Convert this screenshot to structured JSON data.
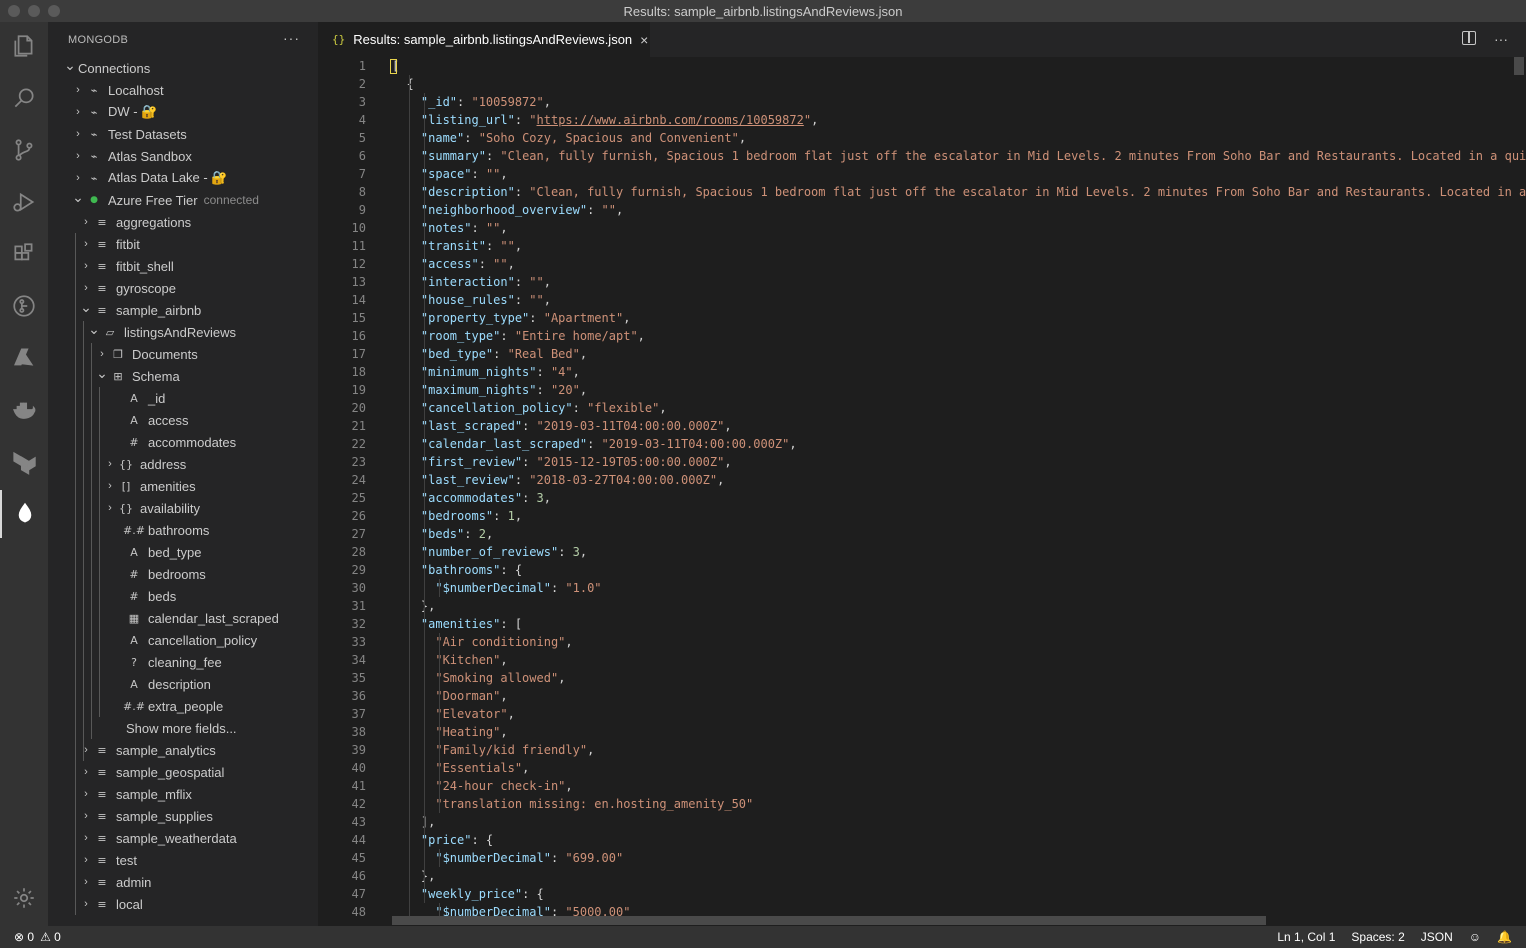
{
  "window": {
    "title": "Results: sample_airbnb.listingsAndReviews.json"
  },
  "activity_bar": [
    {
      "icon": "files-icon"
    },
    {
      "icon": "search-icon"
    },
    {
      "icon": "source-control-icon"
    },
    {
      "icon": "run-debug-icon"
    },
    {
      "icon": "extensions-icon"
    },
    {
      "icon": "gitlens-icon"
    },
    {
      "icon": "azure-icon"
    },
    {
      "icon": "docker-icon"
    },
    {
      "icon": "terraform-icon"
    },
    {
      "icon": "mongodb-leaf-icon",
      "active": true
    }
  ],
  "sidebar": {
    "title": "MONGODB",
    "more": "···",
    "rows": [
      {
        "label": "Connections",
        "chevron": "⌄",
        "icon": "",
        "sub": ""
      },
      {
        "label": "Localhost",
        "chevron": "›",
        "icon": "plug-icon",
        "sub": ""
      },
      {
        "label": "DW - 🔐",
        "chevron": "›",
        "icon": "plug-icon",
        "sub": ""
      },
      {
        "label": "Test Datasets",
        "chevron": "›",
        "icon": "plug-icon",
        "sub": ""
      },
      {
        "label": "Atlas Sandbox",
        "chevron": "›",
        "icon": "plug-icon",
        "sub": ""
      },
      {
        "label": "Atlas Data Lake - 🔐",
        "chevron": "›",
        "icon": "plug-icon",
        "sub": ""
      },
      {
        "label": "Azure Free Tier",
        "chevron": "⌄",
        "icon": "connected-leaf-icon",
        "sub": "connected"
      },
      {
        "label": "aggregations",
        "chevron": "›",
        "icon": "database-icon",
        "sub": ""
      },
      {
        "label": "fitbit",
        "chevron": "›",
        "icon": "database-icon",
        "sub": ""
      },
      {
        "label": "fitbit_shell",
        "chevron": "›",
        "icon": "database-icon",
        "sub": ""
      },
      {
        "label": "gyroscope",
        "chevron": "›",
        "icon": "database-icon",
        "sub": ""
      },
      {
        "label": "sample_airbnb",
        "chevron": "⌄",
        "icon": "database-icon",
        "sub": ""
      },
      {
        "label": "listingsAndReviews",
        "chevron": "⌄",
        "icon": "folder-icon",
        "sub": ""
      },
      {
        "label": "Documents",
        "chevron": "›",
        "icon": "documents-icon",
        "sub": ""
      },
      {
        "label": "Schema",
        "chevron": "⌄",
        "icon": "schema-icon",
        "sub": ""
      },
      {
        "label": "_id",
        "chevron": "",
        "icon": "string-type-icon",
        "sub": ""
      },
      {
        "label": "access",
        "chevron": "",
        "icon": "string-type-icon",
        "sub": ""
      },
      {
        "label": "accommodates",
        "chevron": "",
        "icon": "number-type-icon",
        "sub": ""
      },
      {
        "label": "address",
        "chevron": "›",
        "icon": "object-type-icon",
        "sub": ""
      },
      {
        "label": "amenities",
        "chevron": "›",
        "icon": "array-type-icon",
        "sub": ""
      },
      {
        "label": "availability",
        "chevron": "›",
        "icon": "object-type-icon",
        "sub": ""
      },
      {
        "label": "bathrooms",
        "chevron": "",
        "icon": "decimal-type-icon",
        "sub": ""
      },
      {
        "label": "bed_type",
        "chevron": "",
        "icon": "string-type-icon",
        "sub": ""
      },
      {
        "label": "bedrooms",
        "chevron": "",
        "icon": "number-type-icon",
        "sub": ""
      },
      {
        "label": "beds",
        "chevron": "",
        "icon": "number-type-icon",
        "sub": ""
      },
      {
        "label": "calendar_last_scraped",
        "chevron": "",
        "icon": "date-type-icon",
        "sub": ""
      },
      {
        "label": "cancellation_policy",
        "chevron": "",
        "icon": "string-type-icon",
        "sub": ""
      },
      {
        "label": "cleaning_fee",
        "chevron": "",
        "icon": "unknown-type-icon",
        "sub": ""
      },
      {
        "label": "description",
        "chevron": "",
        "icon": "string-type-icon",
        "sub": ""
      },
      {
        "label": "extra_people",
        "chevron": "",
        "icon": "decimal-type-icon",
        "sub": ""
      },
      {
        "label": "Show more fields...",
        "chevron": "",
        "icon": "",
        "sub": ""
      },
      {
        "label": "sample_analytics",
        "chevron": "›",
        "icon": "database-icon",
        "sub": ""
      },
      {
        "label": "sample_geospatial",
        "chevron": "›",
        "icon": "database-icon",
        "sub": ""
      },
      {
        "label": "sample_mflix",
        "chevron": "›",
        "icon": "database-icon",
        "sub": ""
      },
      {
        "label": "sample_supplies",
        "chevron": "›",
        "icon": "database-icon",
        "sub": ""
      },
      {
        "label": "sample_weatherdata",
        "chevron": "›",
        "icon": "database-icon",
        "sub": ""
      },
      {
        "label": "test",
        "chevron": "›",
        "icon": "database-icon",
        "sub": ""
      },
      {
        "label": "admin",
        "chevron": "›",
        "icon": "database-icon",
        "sub": ""
      },
      {
        "label": "local",
        "chevron": "›",
        "icon": "database-icon",
        "sub": ""
      }
    ]
  },
  "tab": {
    "icon_text": "{}",
    "label": "Results: sample_airbnb.listingsAndReviews.json",
    "close": "×"
  },
  "tab_actions": {
    "more": "···"
  },
  "editor": {
    "lines": [
      [
        [
          "p",
          "["
        ]
      ],
      [
        [
          "p",
          "  {"
        ]
      ],
      [
        [
          "p",
          "    "
        ],
        [
          "k",
          "\"_id\""
        ],
        [
          "p",
          ": "
        ],
        [
          "s",
          "\"10059872\""
        ],
        [
          "p",
          ","
        ]
      ],
      [
        [
          "p",
          "    "
        ],
        [
          "k",
          "\"listing_url\""
        ],
        [
          "p",
          ": "
        ],
        [
          "s",
          "\""
        ],
        [
          "u",
          "https://www.airbnb.com/rooms/10059872"
        ],
        [
          "s",
          "\""
        ],
        [
          "p",
          ","
        ]
      ],
      [
        [
          "p",
          "    "
        ],
        [
          "k",
          "\"name\""
        ],
        [
          "p",
          ": "
        ],
        [
          "s",
          "\"Soho Cozy, Spacious and Convenient\""
        ],
        [
          "p",
          ","
        ]
      ],
      [
        [
          "p",
          "    "
        ],
        [
          "k",
          "\"summary\""
        ],
        [
          "p",
          ": "
        ],
        [
          "s",
          "\"Clean, fully furnish, Spacious 1 bedroom flat just off the escalator in Mid Levels. 2 minutes From Soho Bar and Restaurants. Located in a quie"
        ]
      ],
      [
        [
          "p",
          "    "
        ],
        [
          "k",
          "\"space\""
        ],
        [
          "p",
          ": "
        ],
        [
          "s",
          "\"\""
        ],
        [
          "p",
          ","
        ]
      ],
      [
        [
          "p",
          "    "
        ],
        [
          "k",
          "\"description\""
        ],
        [
          "p",
          ": "
        ],
        [
          "s",
          "\"Clean, fully furnish, Spacious 1 bedroom flat just off the escalator in Mid Levels. 2 minutes From Soho Bar and Restaurants. Located in a"
        ]
      ],
      [
        [
          "p",
          "    "
        ],
        [
          "k",
          "\"neighborhood_overview\""
        ],
        [
          "p",
          ": "
        ],
        [
          "s",
          "\"\""
        ],
        [
          "p",
          ","
        ]
      ],
      [
        [
          "p",
          "    "
        ],
        [
          "k",
          "\"notes\""
        ],
        [
          "p",
          ": "
        ],
        [
          "s",
          "\"\""
        ],
        [
          "p",
          ","
        ]
      ],
      [
        [
          "p",
          "    "
        ],
        [
          "k",
          "\"transit\""
        ],
        [
          "p",
          ": "
        ],
        [
          "s",
          "\"\""
        ],
        [
          "p",
          ","
        ]
      ],
      [
        [
          "p",
          "    "
        ],
        [
          "k",
          "\"access\""
        ],
        [
          "p",
          ": "
        ],
        [
          "s",
          "\"\""
        ],
        [
          "p",
          ","
        ]
      ],
      [
        [
          "p",
          "    "
        ],
        [
          "k",
          "\"interaction\""
        ],
        [
          "p",
          ": "
        ],
        [
          "s",
          "\"\""
        ],
        [
          "p",
          ","
        ]
      ],
      [
        [
          "p",
          "    "
        ],
        [
          "k",
          "\"house_rules\""
        ],
        [
          "p",
          ": "
        ],
        [
          "s",
          "\"\""
        ],
        [
          "p",
          ","
        ]
      ],
      [
        [
          "p",
          "    "
        ],
        [
          "k",
          "\"property_type\""
        ],
        [
          "p",
          ": "
        ],
        [
          "s",
          "\"Apartment\""
        ],
        [
          "p",
          ","
        ]
      ],
      [
        [
          "p",
          "    "
        ],
        [
          "k",
          "\"room_type\""
        ],
        [
          "p",
          ": "
        ],
        [
          "s",
          "\"Entire home/apt\""
        ],
        [
          "p",
          ","
        ]
      ],
      [
        [
          "p",
          "    "
        ],
        [
          "k",
          "\"bed_type\""
        ],
        [
          "p",
          ": "
        ],
        [
          "s",
          "\"Real Bed\""
        ],
        [
          "p",
          ","
        ]
      ],
      [
        [
          "p",
          "    "
        ],
        [
          "k",
          "\"minimum_nights\""
        ],
        [
          "p",
          ": "
        ],
        [
          "s",
          "\"4\""
        ],
        [
          "p",
          ","
        ]
      ],
      [
        [
          "p",
          "    "
        ],
        [
          "k",
          "\"maximum_nights\""
        ],
        [
          "p",
          ": "
        ],
        [
          "s",
          "\"20\""
        ],
        [
          "p",
          ","
        ]
      ],
      [
        [
          "p",
          "    "
        ],
        [
          "k",
          "\"cancellation_policy\""
        ],
        [
          "p",
          ": "
        ],
        [
          "s",
          "\"flexible\""
        ],
        [
          "p",
          ","
        ]
      ],
      [
        [
          "p",
          "    "
        ],
        [
          "k",
          "\"last_scraped\""
        ],
        [
          "p",
          ": "
        ],
        [
          "s",
          "\"2019-03-11T04:00:00.000Z\""
        ],
        [
          "p",
          ","
        ]
      ],
      [
        [
          "p",
          "    "
        ],
        [
          "k",
          "\"calendar_last_scraped\""
        ],
        [
          "p",
          ": "
        ],
        [
          "s",
          "\"2019-03-11T04:00:00.000Z\""
        ],
        [
          "p",
          ","
        ]
      ],
      [
        [
          "p",
          "    "
        ],
        [
          "k",
          "\"first_review\""
        ],
        [
          "p",
          ": "
        ],
        [
          "s",
          "\"2015-12-19T05:00:00.000Z\""
        ],
        [
          "p",
          ","
        ]
      ],
      [
        [
          "p",
          "    "
        ],
        [
          "k",
          "\"last_review\""
        ],
        [
          "p",
          ": "
        ],
        [
          "s",
          "\"2018-03-27T04:00:00.000Z\""
        ],
        [
          "p",
          ","
        ]
      ],
      [
        [
          "p",
          "    "
        ],
        [
          "k",
          "\"accommodates\""
        ],
        [
          "p",
          ": "
        ],
        [
          "n",
          "3"
        ],
        [
          "p",
          ","
        ]
      ],
      [
        [
          "p",
          "    "
        ],
        [
          "k",
          "\"bedrooms\""
        ],
        [
          "p",
          ": "
        ],
        [
          "n",
          "1"
        ],
        [
          "p",
          ","
        ]
      ],
      [
        [
          "p",
          "    "
        ],
        [
          "k",
          "\"beds\""
        ],
        [
          "p",
          ": "
        ],
        [
          "n",
          "2"
        ],
        [
          "p",
          ","
        ]
      ],
      [
        [
          "p",
          "    "
        ],
        [
          "k",
          "\"number_of_reviews\""
        ],
        [
          "p",
          ": "
        ],
        [
          "n",
          "3"
        ],
        [
          "p",
          ","
        ]
      ],
      [
        [
          "p",
          "    "
        ],
        [
          "k",
          "\"bathrooms\""
        ],
        [
          "p",
          ": {"
        ]
      ],
      [
        [
          "p",
          "      "
        ],
        [
          "k",
          "\"$numberDecimal\""
        ],
        [
          "p",
          ": "
        ],
        [
          "s",
          "\"1.0\""
        ]
      ],
      [
        [
          "p",
          "    },"
        ]
      ],
      [
        [
          "p",
          "    "
        ],
        [
          "k",
          "\"amenities\""
        ],
        [
          "p",
          ": ["
        ]
      ],
      [
        [
          "p",
          "      "
        ],
        [
          "s",
          "\"Air conditioning\""
        ],
        [
          "p",
          ","
        ]
      ],
      [
        [
          "p",
          "      "
        ],
        [
          "s",
          "\"Kitchen\""
        ],
        [
          "p",
          ","
        ]
      ],
      [
        [
          "p",
          "      "
        ],
        [
          "s",
          "\"Smoking allowed\""
        ],
        [
          "p",
          ","
        ]
      ],
      [
        [
          "p",
          "      "
        ],
        [
          "s",
          "\"Doorman\""
        ],
        [
          "p",
          ","
        ]
      ],
      [
        [
          "p",
          "      "
        ],
        [
          "s",
          "\"Elevator\""
        ],
        [
          "p",
          ","
        ]
      ],
      [
        [
          "p",
          "      "
        ],
        [
          "s",
          "\"Heating\""
        ],
        [
          "p",
          ","
        ]
      ],
      [
        [
          "p",
          "      "
        ],
        [
          "s",
          "\"Family/kid friendly\""
        ],
        [
          "p",
          ","
        ]
      ],
      [
        [
          "p",
          "      "
        ],
        [
          "s",
          "\"Essentials\""
        ],
        [
          "p",
          ","
        ]
      ],
      [
        [
          "p",
          "      "
        ],
        [
          "s",
          "\"24-hour check-in\""
        ],
        [
          "p",
          ","
        ]
      ],
      [
        [
          "p",
          "      "
        ],
        [
          "s",
          "\"translation missing: en.hosting_amenity_50\""
        ]
      ],
      [
        [
          "p",
          "    ],"
        ]
      ],
      [
        [
          "p",
          "    "
        ],
        [
          "k",
          "\"price\""
        ],
        [
          "p",
          ": {"
        ]
      ],
      [
        [
          "p",
          "      "
        ],
        [
          "k",
          "\"$numberDecimal\""
        ],
        [
          "p",
          ": "
        ],
        [
          "s",
          "\"699.00\""
        ]
      ],
      [
        [
          "p",
          "    },"
        ]
      ],
      [
        [
          "p",
          "    "
        ],
        [
          "k",
          "\"weekly_price\""
        ],
        [
          "p",
          ": {"
        ]
      ],
      [
        [
          "p",
          "      "
        ],
        [
          "k",
          "\"$numberDecimal\""
        ],
        [
          "p",
          ": "
        ],
        [
          "s",
          "\"5000.00\""
        ]
      ]
    ]
  },
  "statusbar": {
    "errors": "⊗ 0",
    "warnings": "⚠ 0",
    "position": "Ln 1, Col 1",
    "spaces": "Spaces: 2",
    "language": "JSON"
  }
}
